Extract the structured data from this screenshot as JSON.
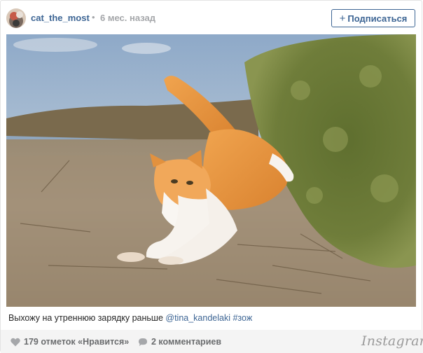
{
  "post": {
    "username": "cat_the_most",
    "separator": "•",
    "time": "6 мес. назад",
    "follow_label": "Подписаться",
    "follow_plus": "+",
    "caption": {
      "text": "Выхожу на утреннюю зарядку раньше ",
      "mention": "@tina_kandelaki",
      "hashtag": "#зож"
    },
    "likes": "179 отметок «Нравится»",
    "comments": "2 комментариев",
    "brand": "Instagram"
  },
  "icons": {
    "avatar": "avatar",
    "user_tag": "user-tag-icon",
    "like": "heart-icon",
    "comment": "comment-bubble-icon"
  },
  "colors": {
    "link": "#3d6594",
    "muted": "#a5a7aa",
    "footer_bg": "#f4f4f4"
  }
}
